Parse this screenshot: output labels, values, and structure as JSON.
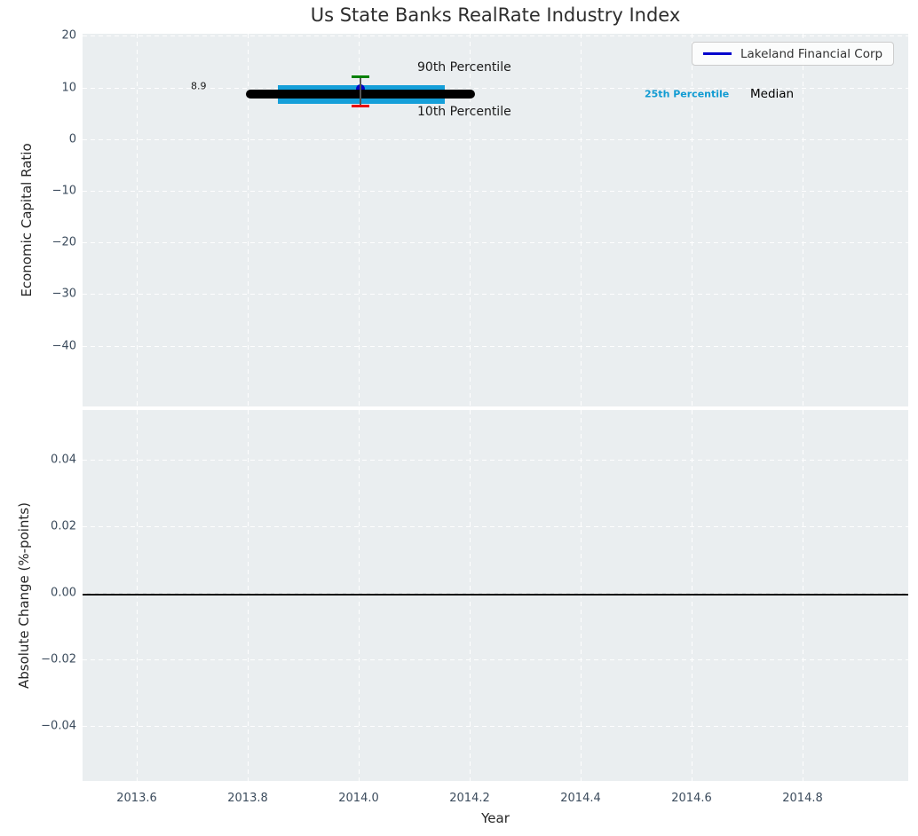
{
  "chart_data": [
    {
      "type": "scatter",
      "title": "Us State Banks RealRate Industry Index",
      "ylabel": "Economic Capital Ratio",
      "xlabel": "",
      "xlim": [
        2013.5,
        2015.0
      ],
      "ylim": [
        -52,
        20.5
      ],
      "yticks": [
        20,
        10,
        0,
        -10,
        -20,
        -30,
        -40
      ],
      "ytick_labels": [
        "20",
        "10",
        "0",
        "−10",
        "−20",
        "−30",
        "−40"
      ],
      "grid": "white-dashed",
      "background_color": "#eaeef0",
      "legend": {
        "location": "upper right",
        "entries": [
          {
            "label": "Lakeland Financial Corp",
            "color": "#0000cd",
            "type": "line"
          }
        ]
      },
      "series": [
        {
          "name": "Lakeland Financial Corp",
          "type": "point-with-errorbar",
          "color": "#0000c4",
          "x": 2014.0,
          "y": 8.9,
          "err_high": 12.1,
          "err_low": 6.6,
          "cap_high_color": "#008000",
          "cap_low_color": "#e8000b"
        }
      ],
      "industry_lines": [
        {
          "name": "Median",
          "value": 8.9,
          "x_start": 2013.8,
          "x_end": 2014.2,
          "color": "#000000",
          "linewidth": 10
        },
        {
          "name": "25th Percentile",
          "value": 8.7,
          "x_start": 2013.85,
          "x_end": 2014.15,
          "color": "#159fd9",
          "linewidth": 21
        }
      ],
      "annotations": [
        {
          "text": "8.9",
          "x": 2013.72,
          "y": 8.9,
          "color": "#1a1a1a"
        },
        {
          "text": "90th Percentile",
          "x": 2014.1,
          "y": 13.5,
          "color": "#1a1a1a"
        },
        {
          "text": "10th Percentile",
          "x": 2014.1,
          "y": 5.0,
          "color": "#1a1a1a"
        },
        {
          "text": "25th Percentile",
          "x": 2014.52,
          "y": 8.8,
          "color": "#119bd2"
        },
        {
          "text": "Median",
          "x": 2014.71,
          "y": 8.8,
          "color": "#000000"
        }
      ]
    },
    {
      "type": "line",
      "title": "",
      "ylabel": "Absolute Change (%-points)",
      "xlabel": "Year",
      "xlim": [
        2013.5,
        2015.0
      ],
      "ylim": [
        -0.057,
        0.055
      ],
      "yticks": [
        0.04,
        0.02,
        0.0,
        -0.02,
        -0.04
      ],
      "ytick_labels": [
        "0.04",
        "0.02",
        "0.00",
        "−0.02",
        "−0.04"
      ],
      "xticks": [
        2013.6,
        2013.8,
        2014.0,
        2014.2,
        2014.4,
        2014.6,
        2014.8
      ],
      "xtick_labels": [
        "2013.6",
        "2013.8",
        "2014.0",
        "2014.2",
        "2014.4",
        "2014.6",
        "2014.8"
      ],
      "zero_line": 0.0,
      "grid": "white-dashed",
      "background_color": "#eaeef0",
      "series": []
    }
  ]
}
